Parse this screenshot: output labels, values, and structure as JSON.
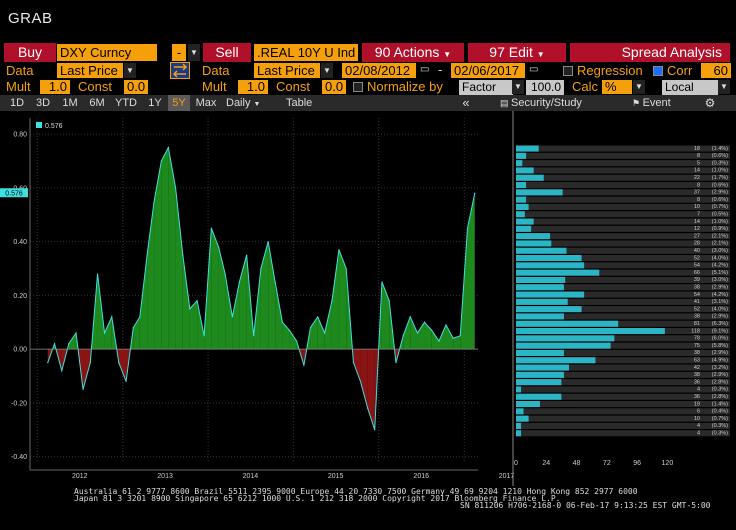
{
  "app_title": "GRAB",
  "row1": {
    "buy_label": "Buy",
    "buy_security": "DXY Curncy",
    "sep_value": "-",
    "sell_label": "Sell",
    "sell_security": ".REAL 10Y U Ind",
    "actions_label": "90 Actions",
    "edit_label": "97 Edit",
    "spread_label": "Spread Analysis"
  },
  "row2": {
    "data_label_1": "Data",
    "data_value_1": "Last Price",
    "data_label_2": "Data",
    "data_value_2": "Last Price",
    "date_from": "02/08/2012",
    "date_to": "02/06/2017",
    "regression_label": "Regression",
    "corr_label": "Corr",
    "corr_value": "60"
  },
  "row3": {
    "mult_label_1": "Mult",
    "mult_value_1": "1.0",
    "const_label_1": "Const",
    "const_value_1": "0.0",
    "mult_label_2": "Mult",
    "mult_value_2": "1.0",
    "const_label_2": "Const",
    "const_value_2": "0.0",
    "normalize_label": "Normalize by",
    "factor_value": "Factor",
    "factor_num": "100.0",
    "calc_label": "Calc",
    "calc_value": "%",
    "local_value": "Local"
  },
  "tabs": {
    "items": [
      "1D",
      "3D",
      "1M",
      "6M",
      "YTD",
      "1Y",
      "5Y",
      "Max"
    ],
    "active": "5Y",
    "freq": "Daily",
    "table_label": "Table",
    "security_study": "Security/Study",
    "event_label": "Event",
    "gear_icon": "gear-icon",
    "collapse_icon": "double-chevron-left-icon"
  },
  "colors": {
    "positive_fill": "#1e8a1e",
    "negative_fill": "#8a1414",
    "line": "#40e0e0",
    "histogram": "#2bb5c5",
    "accent": "#f5a00a",
    "red_button": "#b0102a"
  },
  "chart_data": [
    {
      "type": "area",
      "legend_value": "0.576",
      "last_value_tag": "0.576",
      "y_ticks": [
        "0.80",
        "0.60",
        "0.40",
        "0.20",
        "0.00",
        "-0.20",
        "-0.40"
      ],
      "ylim": [
        -0.42,
        0.86
      ],
      "x_ticks": [
        "2012",
        "2013",
        "2014",
        "2015",
        "2016",
        "2017"
      ],
      "x": [
        "2012-02",
        "2012-03",
        "2012-04",
        "2012-05",
        "2012-06",
        "2012-07",
        "2012-08",
        "2012-09",
        "2012-10",
        "2012-11",
        "2012-12",
        "2013-01",
        "2013-02",
        "2013-03",
        "2013-04",
        "2013-05",
        "2013-06",
        "2013-07",
        "2013-08",
        "2013-09",
        "2013-10",
        "2013-11",
        "2013-12",
        "2014-01",
        "2014-02",
        "2014-03",
        "2014-04",
        "2014-05",
        "2014-06",
        "2014-07",
        "2014-08",
        "2014-09",
        "2014-10",
        "2014-11",
        "2014-12",
        "2015-01",
        "2015-02",
        "2015-03",
        "2015-04",
        "2015-05",
        "2015-06",
        "2015-07",
        "2015-08",
        "2015-09",
        "2015-10",
        "2015-11",
        "2015-12",
        "2016-01",
        "2016-02",
        "2016-03",
        "2016-04",
        "2016-05",
        "2016-06",
        "2016-07",
        "2016-08",
        "2016-09",
        "2016-10",
        "2016-11",
        "2016-12",
        "2017-01",
        "2017-02"
      ],
      "y": [
        -0.05,
        0.02,
        -0.08,
        0.02,
        0.06,
        -0.15,
        -0.05,
        0.28,
        0.06,
        0.12,
        -0.05,
        -0.12,
        0.08,
        0.12,
        0.35,
        0.55,
        0.7,
        0.75,
        0.6,
        0.35,
        0.15,
        0.18,
        0.05,
        0.45,
        0.38,
        0.28,
        0.12,
        0.25,
        0.35,
        0.05,
        0.3,
        0.4,
        0.25,
        0.1,
        0.07,
        0.03,
        -0.06,
        0.08,
        0.12,
        0.06,
        0.18,
        0.37,
        0.3,
        -0.05,
        -0.12,
        -0.22,
        -0.3,
        0.25,
        0.18,
        -0.05,
        0.05,
        0.12,
        0.06,
        0.1,
        0.07,
        0.03,
        0.09,
        0.04,
        0.05,
        0.45,
        0.58
      ]
    },
    {
      "type": "bar",
      "orientation": "horizontal",
      "x_ticks": [
        "0",
        "24",
        "48",
        "72",
        "96",
        "120"
      ],
      "xlim": [
        0,
        130
      ],
      "counts": [
        18,
        8,
        5,
        14,
        22,
        8,
        37,
        8,
        10,
        7,
        14,
        12,
        27,
        28,
        40,
        52,
        54,
        66,
        39,
        38,
        54,
        41,
        52,
        38,
        81,
        118,
        78,
        75,
        38,
        63,
        42,
        38,
        36,
        4,
        36,
        19,
        6,
        10,
        4,
        4
      ],
      "labels": [
        "(1.4%)",
        "(0.6%)",
        "(0.3%)",
        "(1.0%)",
        "(1.7%)",
        "(0.6%)",
        "(2.9%)",
        "(0.6%)",
        "(0.7%)",
        "(0.5%)",
        "(1.0%)",
        "(0.9%)",
        "(2.1%)",
        "(2.1%)",
        "(3.0%)",
        "(4.0%)",
        "(4.2%)",
        "(5.1%)",
        "(3.0%)",
        "(2.9%)",
        "(4.2%)",
        "(3.1%)",
        "(4.0%)",
        "(2.9%)",
        "(6.3%)",
        "(9.1%)",
        "(6.0%)",
        "(5.8%)",
        "(2.9%)",
        "(4.9%)",
        "(3.2%)",
        "(2.9%)",
        "(2.8%)",
        "(0.3%)",
        "(2.8%)",
        "(1.4%)",
        "(0.4%)",
        "(0.7%)",
        "(0.3%)",
        "(0.3%)"
      ]
    }
  ],
  "footer": {
    "line1": "Australia 61 2 9777 8600  Brazil 5511 2395 9000  Europe 44 20 7330 7500  Germany 49 69 9204 1210  Hong Kong 852 2977 6000",
    "line2": "Japan 81 3 3201 8900        Singapore 65 6212 1000        U.S. 1 212 318 2000        Copyright 2017 Bloomberg Finance L.P.",
    "line3": "SN 811206 H706-2168-0 06-Feb-17  9:13:25 EST  GMT-5:00"
  }
}
